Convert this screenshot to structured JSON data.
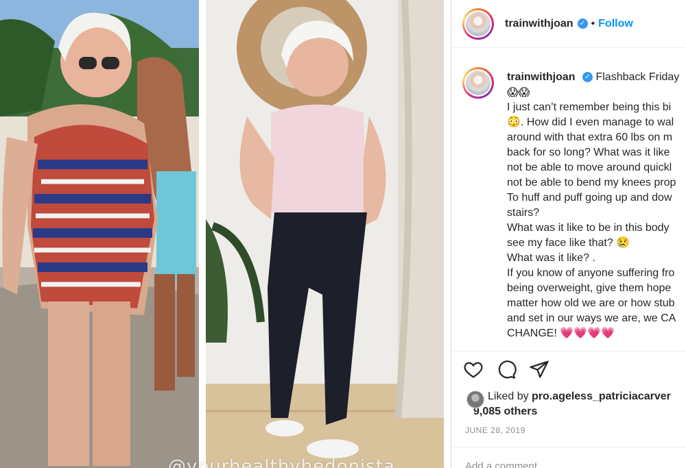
{
  "post": {
    "author": "trainwithjoan",
    "follow_label": "Follow",
    "watermark": "@yourhealthyhedonista",
    "caption_header": "Flashback Friday",
    "caption_lines": [
      "I just can’t remember being this bi",
      "😳. How did I even manage to wal",
      "around with that extra 60 lbs on m",
      "back for so long? What was it like",
      "not be able to move around quickl",
      "not be able to bend my knees prop",
      "To huff and puff going up and dow",
      "stairs?",
      "What was it like to be in this body",
      "see my face like that? 😢",
      "What was it like? .",
      "If you know of anyone suffering fro",
      "being overweight, give them hope",
      "matter how old we are or how stub",
      "and set in our ways we are, we CA",
      "CHANGE! 💗💗💗💗"
    ],
    "caption_emoji_line": "😱😱",
    "liked_by_prefix": "Liked by",
    "liked_by_user": "pro.ageless_patriciacarver",
    "others_count": "9,085 others",
    "date": "JUNE 28, 2019",
    "add_comment_placeholder": "Add a comment…"
  }
}
